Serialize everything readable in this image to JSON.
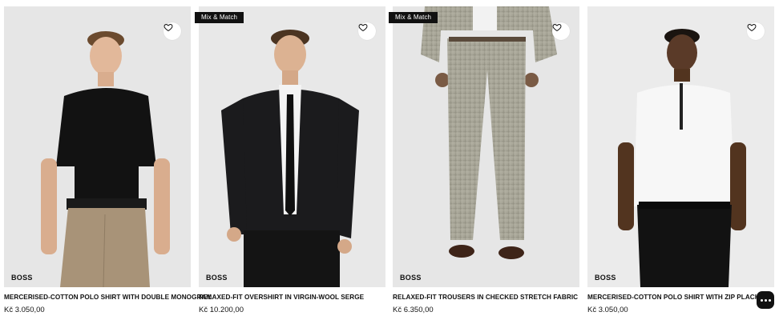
{
  "products": [
    {
      "name": "MERCERISED-COTTON POLO SHIRT WITH DOUBLE MONOGRAM",
      "price": "Kč 3.050,00",
      "brand": "BOSS",
      "badge": "",
      "image": "model-black-polo-beige-trousers"
    },
    {
      "name": "RELAXED-FIT OVERSHIRT IN VIRGIN-WOOL SERGE",
      "price": "Kč 10.200,00",
      "brand": "BOSS",
      "badge": "Mix & Match",
      "image": "model-black-overshirt-tie"
    },
    {
      "name": "RELAXED-FIT TROUSERS IN CHECKED STRETCH FABRIC",
      "price": "Kč 6.350,00",
      "brand": "BOSS",
      "badge": "Mix & Match",
      "image": "model-checked-grey-trousers-brown-shoes"
    },
    {
      "name": "MERCERISED-COTTON POLO SHIRT WITH ZIP PLACKET",
      "price": "Kč 3.050,00",
      "brand": "BOSS",
      "badge": "",
      "image": "model-white-zip-polo-black-trousers"
    }
  ],
  "icons": {
    "wishlist": "heart-icon",
    "chat": "chat-dots-icon"
  }
}
